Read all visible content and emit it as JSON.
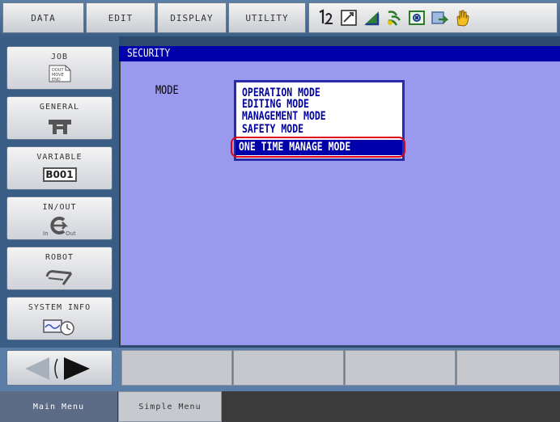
{
  "menu": {
    "data_label": "DATA",
    "edit_label": "EDIT",
    "display_label": "DISPLAY",
    "utility_label": "UTILITY"
  },
  "status_icons": [
    "coordinate-icon",
    "edit-mode-icon",
    "speed-icon",
    "cycle-icon",
    "security-icon",
    "step-icon",
    "hand-icon"
  ],
  "left_menu": {
    "items": [
      {
        "label": "JOB",
        "icon_text": "DOUT MOVE END"
      },
      {
        "label": "GENERAL"
      },
      {
        "label": "VARIABLE",
        "icon_text": "B001"
      },
      {
        "label": "IN/OUT",
        "icon_in": "In",
        "icon_out": "Out"
      },
      {
        "label": "ROBOT"
      },
      {
        "label": "SYSTEM INFO"
      }
    ]
  },
  "screen": {
    "title": "SECURITY",
    "mode_label": "MODE",
    "mode_options": [
      "OPERATION MODE",
      "EDITING MODE",
      "MANAGEMENT MODE",
      "SAFETY MODE",
      "ONE TIME MANAGE MODE"
    ],
    "selected_option": "ONE TIME MANAGE MODE"
  },
  "footer": {
    "main_menu_label": "Main Menu",
    "simple_menu_label": "Simple Menu"
  },
  "colors": {
    "title_bar": "#0000aa",
    "content_bg": "#9999ee",
    "highlight": "#e00018"
  }
}
